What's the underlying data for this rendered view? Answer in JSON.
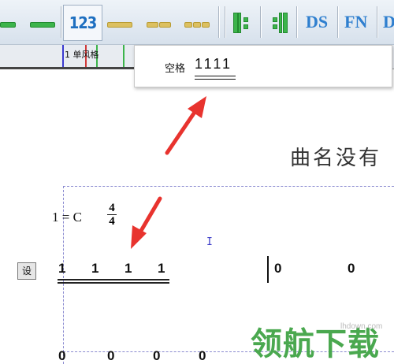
{
  "toolbar": {
    "numbers_label": "123",
    "ds_label": "DS",
    "fn_label": "FN",
    "d_label": "D"
  },
  "tab": {
    "label": "1 单风格"
  },
  "popup": {
    "label": "空格",
    "notes": "1111"
  },
  "score": {
    "title": "曲名没有",
    "key": "1 = C",
    "time_top": "4",
    "time_bottom": "4",
    "cursor": "I",
    "side_button": "设",
    "notes": [
      "1",
      "1",
      "1",
      "1"
    ],
    "rests": [
      "0",
      "0"
    ],
    "bottom_rests": [
      "0",
      "0",
      "0",
      "0",
      "0",
      "0"
    ]
  },
  "watermark": {
    "text": "领航下载",
    "sub": "lhdown.com"
  },
  "colors": {
    "accent": "#2f7fcf",
    "green": "#3cb44b",
    "arrow": "#e8332e"
  }
}
